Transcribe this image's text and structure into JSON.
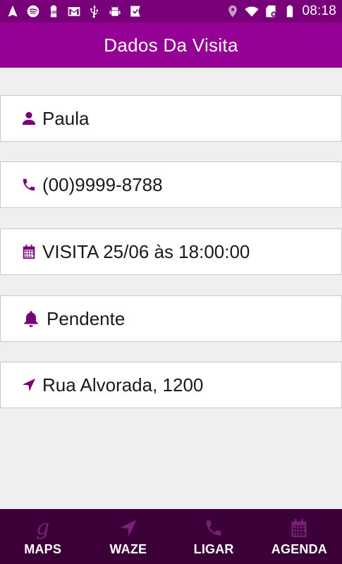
{
  "status_bar": {
    "time": "08:18",
    "icons_left": [
      "navigation-icon",
      "spotify-icon",
      "battery-100-icon",
      "gmail-icon",
      "usb-icon",
      "android-debug-icon",
      "check-badge-icon"
    ],
    "icons_right": [
      "location-icon",
      "wifi-icon",
      "sd-card-icon",
      "battery-icon"
    ]
  },
  "app_bar": {
    "title": "Dados Da Visita"
  },
  "details": {
    "name": {
      "icon": "user-icon",
      "text": "Paula"
    },
    "phone": {
      "icon": "phone-icon",
      "text": "(00)9999-8788"
    },
    "visit": {
      "icon": "calendar-icon",
      "text": "VISITA 25/06 às 18:00:00"
    },
    "status": {
      "icon": "bell-icon",
      "text": "Pendente"
    },
    "address": {
      "icon": "location-arrow-icon",
      "text": "Rua Alvorada, 1200"
    }
  },
  "bottom_nav": {
    "maps": {
      "icon": "google-g-icon",
      "glyph": "g",
      "label": "MAPS"
    },
    "waze": {
      "icon": "location-arrow-icon",
      "label": "WAZE"
    },
    "ligar": {
      "icon": "phone-icon",
      "label": "LIGAR"
    },
    "agenda": {
      "icon": "calendar-icon",
      "label": "AGENDA"
    }
  },
  "colors": {
    "status_bar": "#780078",
    "app_bar": "#950095",
    "accent_icon": "#780078",
    "bottom_nav": "#3b0038",
    "bottom_nav_icon": "#7a1f78",
    "background": "#efefef"
  }
}
